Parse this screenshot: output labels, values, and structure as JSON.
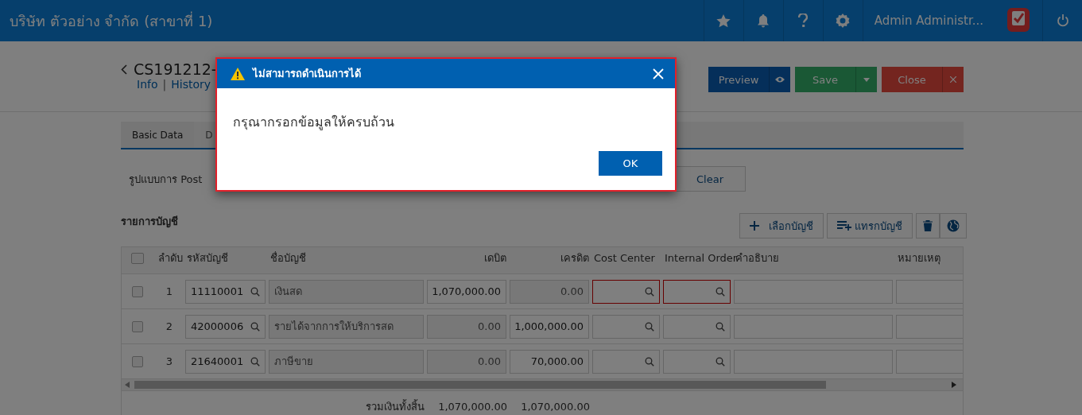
{
  "topbar": {
    "company": "บริษัท ตัวอย่าง จำกัด (สาขาที่ 1)",
    "user": "Admin Administr..."
  },
  "document": {
    "title": "CS191212-",
    "links": [
      "Info",
      "History"
    ],
    "link_separator": "|"
  },
  "actions": [
    {
      "kind": "preview",
      "label": "Preview"
    },
    {
      "kind": "save",
      "label": "Save"
    },
    {
      "kind": "close",
      "label": "Close"
    }
  ],
  "tabs": [
    {
      "label": "Basic Data",
      "selected": true
    },
    {
      "label": "D",
      "selected": false
    }
  ],
  "posting": {
    "label": "รูปแบบการ Post",
    "clear": "Clear"
  },
  "accounts": {
    "title": "รายการบัญชี",
    "tools": [
      {
        "kind": "select",
        "label": "เลือกบัญชี"
      },
      {
        "kind": "insert",
        "label": "แทรกบัญชี"
      },
      {
        "kind": "delete"
      },
      {
        "kind": "globe"
      }
    ],
    "header_checked": false,
    "columns": [
      "ลำดับ",
      "รหัสบัญชี",
      "ชื่อบัญชี",
      "เดบิต",
      "เครดิต",
      "Cost Center",
      "Internal Order",
      "คำอธิบาย",
      "หมายเหตุ"
    ],
    "rows": [
      {
        "checked": false,
        "no": "1",
        "code": "11110001",
        "name": "เงินสด",
        "debit": {
          "value": "1,070,000.00",
          "disabled": false
        },
        "credit": {
          "value": "0.00",
          "disabled": true
        },
        "cost_center_invalid": true,
        "internal_order_invalid": true
      },
      {
        "checked": false,
        "no": "2",
        "code": "42000006",
        "name": "รายได้จากการให้บริการสด",
        "debit": {
          "value": "0.00",
          "disabled": true
        },
        "credit": {
          "value": "1,000,000.00",
          "disabled": false
        },
        "cost_center_invalid": false,
        "internal_order_invalid": false
      },
      {
        "checked": false,
        "no": "3",
        "code": "21640001",
        "name": "ภาษีขาย",
        "debit": {
          "value": "0.00",
          "disabled": true
        },
        "credit": {
          "value": "70,000.00",
          "disabled": false
        },
        "cost_center_invalid": false,
        "internal_order_invalid": false
      }
    ],
    "total": {
      "label": "รวมเงินทั้งสิ้น",
      "debit": "1,070,000.00",
      "credit": "1,070,000.00"
    }
  },
  "dialog": {
    "title": "ไม่สามารถดำเนินการได้",
    "message": "กรุณากรอกข้อมูลให้ครบถ้วน",
    "ok": "OK"
  }
}
